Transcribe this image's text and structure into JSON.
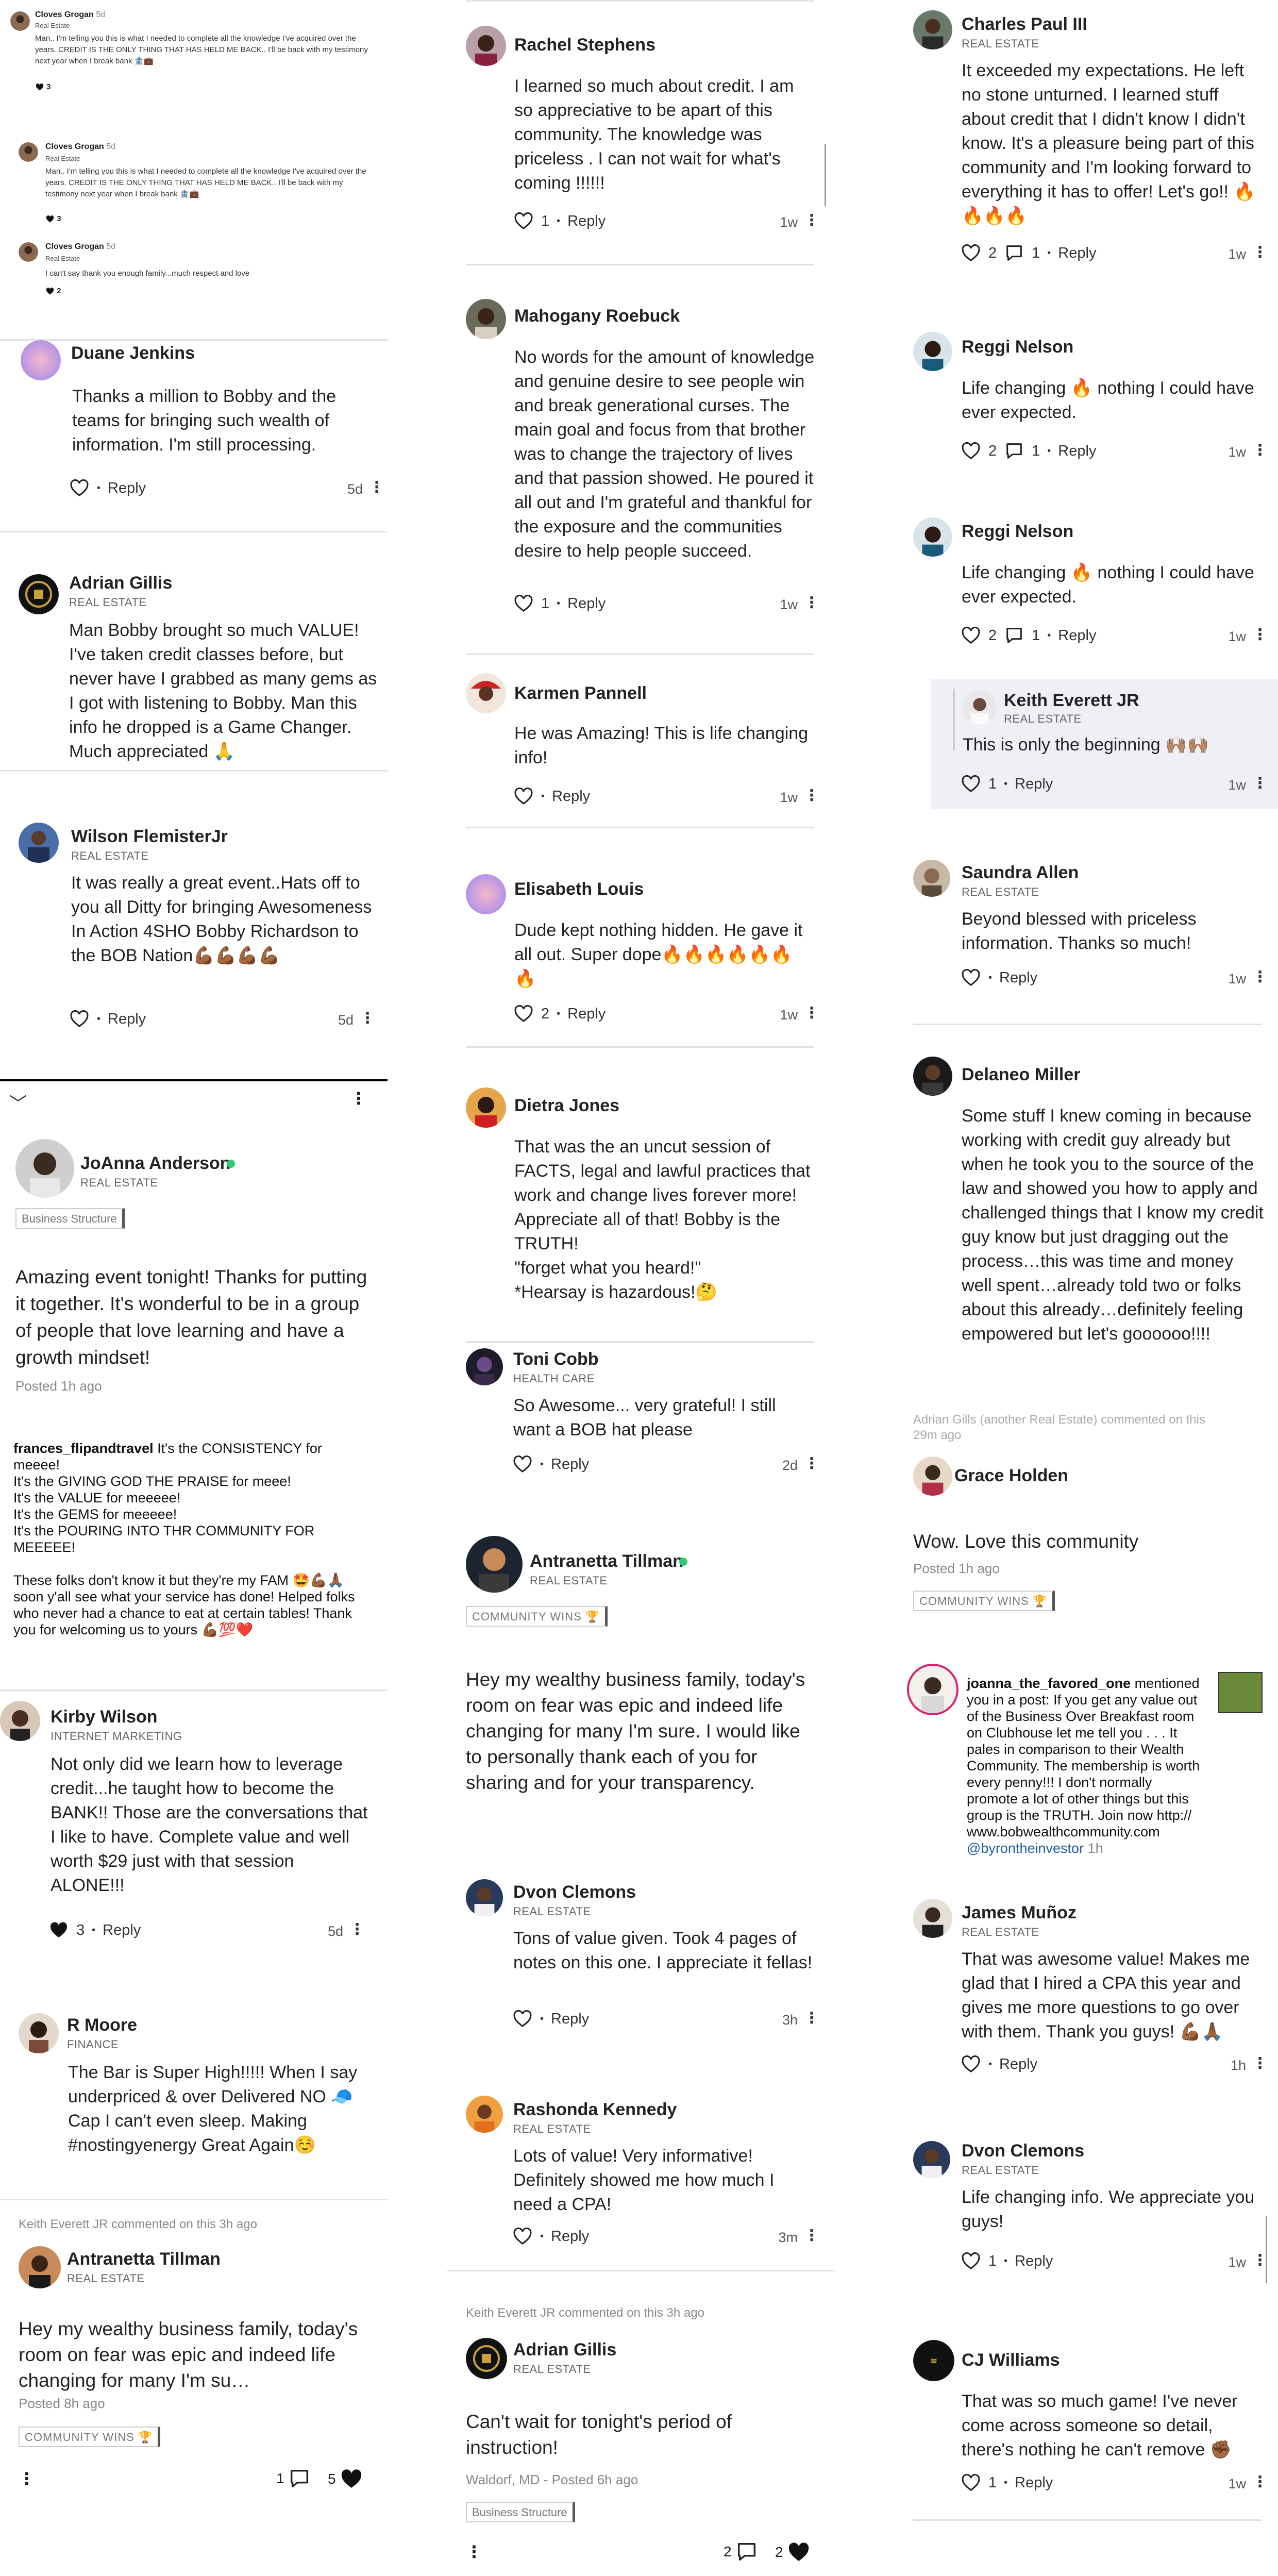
{
  "col1": {
    "top": {
      "c1_name": "Cloves Grogan",
      "c1_time": "5d",
      "c1_role": "Real Estate",
      "c1_text": "Man.. I'm telling you this is what I needed to complete all the knowledge I've acquired over the years. CREDIT IS THE ONLY THING THAT HAS HELD ME BACK.. I'll be back with my testimony next year when I break bank 🏦💼",
      "c1_likes": "3",
      "c2_name": "Cloves Grogan",
      "c2_time": "5d",
      "c2_role": "Real Estate",
      "c2_text": "Man.. I'm telling you this is what I needed to complete all the knowledge I've acquired over the years. CREDIT IS THE ONLY THING THAT HAS HELD ME BACK.. I'll be back with my testimony next year when I break bank 🏦💼",
      "c2_likes": "3",
      "c3_name": "Cloves Grogan",
      "c3_time": "5d",
      "c3_role": "Real Estate",
      "c3_text": "I can't say thank you enough family...much respect and love",
      "c3_likes": "2"
    },
    "duane": {
      "name": "Duane Jenkins",
      "text": "Thanks a million to Bobby and the teams for bringing such wealth of information. I'm still processing.",
      "reply": "Reply",
      "time": "5d"
    },
    "adrian": {
      "name": "Adrian Gillis",
      "role": "REAL ESTATE",
      "text": "Man Bobby brought so much VALUE! I've taken credit classes before, but never have I grabbed as many gems as I got with listening to Bobby. Man this info he dropped is a Game Changer. Much appreciated 🙏"
    },
    "wilson": {
      "name": "Wilson FlemisterJr",
      "role": "REAL ESTATE",
      "text": "It was really a great event..Hats off to you all Ditty for bringing Awesomeness In Action 4SHO Bobby Richardson to the BOB Nation💪🏾💪🏾💪🏾💪🏾",
      "reply": "Reply",
      "time": "5d"
    },
    "joanna": {
      "name": "JoAnna Anderson",
      "role": "REAL ESTATE",
      "tag": "Business Structure",
      "text": "Amazing event tonight! Thanks for putting it together. It's wonderful to be in a group of people that love learning and have a growth mindset!",
      "posted": "Posted 1h ago"
    },
    "frances": {
      "user": "frances_flipandtravel",
      "lines": [
        "It's the CONSISTENCY for",
        "meeee!",
        "It's the GIVING GOD THE PRAISE for meee!",
        "It's the VALUE for meeeee!",
        "It's the GEMS for meeeee!",
        "It's the POURING INTO THR COMMUNITY FOR",
        "MEEEEE!",
        "",
        "These folks don't know it but they're my FAM 🤩💪🏾🙏🏾",
        "soon y'all see what your service has done! Helped folks",
        "who never had a chance to eat at certain tables! Thank",
        "you for welcoming us to yours 💪🏾💯❤️"
      ]
    },
    "kirby": {
      "name": "Kirby Wilson",
      "role": "INTERNET MARKETING",
      "text": "Not only did we learn how to leverage credit...he taught how to become the BANK!! Those are the conversations that I like to have. Complete value and well worth $29 just with that session ALONE!!!",
      "likes": "3",
      "reply": "Reply",
      "time": "5d"
    },
    "rmoore": {
      "name": "R Moore",
      "role": "FINANCE",
      "text": "The Bar is Super High!!!!! When I say underpriced & over Delivered NO 🧢 Cap I can't even sleep. Making #nostingyenergy Great Again☺️"
    },
    "antra": {
      "commented": "Keith Everett JR commented on this 3h ago",
      "name": "Antranetta Tillman",
      "role": "REAL ESTATE",
      "text": "Hey my wealthy business family, today's room on fear was epic and indeed life changing for many I'm su…",
      "posted": "Posted 8h ago",
      "tag": "COMMUNITY WINS 🏆",
      "comments": "1",
      "likes": "5"
    }
  },
  "col2": {
    "rachel": {
      "name": "Rachel Stephens",
      "text": "I learned so much about credit. I am so appreciative to be apart of this community. The knowledge was priceless . I can not wait for what's coming !!!!!!",
      "likes": "1",
      "reply": "Reply",
      "time": "1w"
    },
    "mahogany": {
      "name": "Mahogany Roebuck",
      "text": "No words for the amount of knowledge and genuine desire to see people win and  break generational curses. The main goal and focus from that brother was to change the trajectory of lives and that passion showed. He poured it all out and I'm grateful and thankful for the exposure and the communities desire to help people succeed.",
      "likes": "1",
      "reply": "Reply",
      "time": "1w"
    },
    "karmen": {
      "name": "Karmen Pannell",
      "text": "He was Amazing! This is life changing info!",
      "reply": "Reply",
      "time": "1w"
    },
    "elisabeth": {
      "name": "Elisabeth Louis",
      "text": "Dude kept nothing hidden. He gave it all out. Super dope🔥🔥🔥🔥🔥🔥🔥",
      "likes": "2",
      "reply": "Reply",
      "time": "1w"
    },
    "dietra": {
      "name": "Dietra Jones",
      "text1": "That was the an uncut session of FACTS, legal and lawful practices that work and change lives forever more! Appreciate all of that! Bobby is the TRUTH!",
      "text2": "\"forget what you heard!\"",
      "text3": "*Hearsay is hazardous!🤔"
    },
    "toni": {
      "name": "Toni Cobb",
      "role": "HEALTH CARE",
      "text": "So Awesome... very grateful! I still want a BOB hat please",
      "reply": "Reply",
      "time": "2d"
    },
    "antra": {
      "name": "Antranetta Tillman",
      "role": "REAL ESTATE",
      "tag": "COMMUNITY WINS 🏆",
      "text": "Hey my wealthy business family, today's room on fear was epic and indeed life changing for many I'm sure. I would like to personally thank each of you for sharing and for your transparency."
    },
    "dvon": {
      "name": "Dvon Clemons",
      "role": "REAL ESTATE",
      "text": "Tons of value given. Took 4 pages of notes on this one. I appreciate it fellas!",
      "reply": "Reply",
      "time": "3h"
    },
    "rashonda": {
      "name": "Rashonda Kennedy",
      "role": "REAL ESTATE",
      "text": "Lots of value! Very informative! Definitely showed me how much I need a CPA!",
      "reply": "Reply",
      "time": "3m"
    },
    "adrian2": {
      "commented": "Keith Everett JR commented on this 3h ago",
      "name": "Adrian Gillis",
      "role": "REAL ESTATE",
      "text": "Can't wait for tonight's period of instruction!",
      "posted": "Waldorf, MD - Posted 6h ago",
      "tag": "Business Structure",
      "comments": "2",
      "likes": "2"
    }
  },
  "col3": {
    "charles": {
      "name": "Charles Paul III",
      "role": "REAL ESTATE",
      "text": "It exceeded my expectations. He left no stone unturned. I learned stuff about credit that I didn't know I didn't know. It's a pleasure being part of this community and I'm looking forward to everything it has to offer! Let's go!! 🔥🔥🔥🔥",
      "likes": "2",
      "comments": "1",
      "reply": "Reply",
      "time": "1w"
    },
    "reggi1": {
      "name": "Reggi Nelson",
      "text": "Life changing 🔥 nothing I could have ever expected.",
      "likes": "2",
      "comments": "1",
      "reply": "Reply",
      "time": "1w"
    },
    "reggi2": {
      "name": "Reggi Nelson",
      "text": "Life changing 🔥 nothing I could have ever expected.",
      "likes": "2",
      "comments": "1",
      "reply": "Reply",
      "time": "1w"
    },
    "keith": {
      "name": "Keith Everett JR",
      "role": "REAL ESTATE",
      "text": "This is only the beginning 🙌🏽🙌🏽",
      "likes": "1",
      "reply": "Reply",
      "time": "1w"
    },
    "saundra": {
      "name": "Saundra Allen",
      "role": "REAL ESTATE",
      "text": "Beyond blessed with priceless information. Thanks so much!",
      "reply": "Reply",
      "time": "1w"
    },
    "delaneo": {
      "name": "Delaneo Miller",
      "text": "Some stuff I knew coming in because working with credit guy already but when he took you to the source of the law and showed you how to apply and challenged things that I know my credit guy know but just dragging out the process…this was time and money well spent…already told two or folks about this already…definitely feeling empowered but let's goooooo!!!!"
    },
    "grace": {
      "commented1": "Adrian Gills (another Real Estate) commented on this",
      "commented2": "29m ago",
      "name": "Grace Holden",
      "text": "Wow. Love this community",
      "posted": "Posted 1h ago",
      "tag": "COMMUNITY WINS 🏆"
    },
    "joanna_ig": {
      "user": "joanna_the_favored_one",
      "lines": [
        "mentioned",
        "you in a post: If you get any value out",
        "of the Business Over Breakfast room",
        "on Clubhouse let me tell you . . . It",
        "pales in comparison to their Wealth",
        "Community. The membership is worth",
        "every penny!!! I don't normally",
        "promote a lot of other things but this",
        "group is the TRUTH. Join now http://",
        "www.bobwealthcommunity.com"
      ],
      "mention": "@byrontheinvestor",
      "time": "1h"
    },
    "james": {
      "name": "James Muñoz",
      "role": "REAL ESTATE",
      "text": "That was awesome value! Makes me glad that I hired a CPA this year and gives me more questions to go over with them. Thank you guys! 💪🏾🙏🏾",
      "reply": "Reply",
      "time": "1h"
    },
    "dvon2": {
      "name": "Dvon Clemons",
      "role": "REAL ESTATE",
      "text": "Life changing info. We appreciate you guys!",
      "likes": "1",
      "reply": "Reply",
      "time": "1w"
    },
    "cj": {
      "name": "CJ Williams",
      "text": "That was so much game! I've never come across someone so detail, there's nothing he can't remove ✊🏾",
      "likes": "1",
      "reply": "Reply",
      "time": "1w"
    }
  },
  "common": {
    "reply": "Reply",
    "kebab": "⋮",
    "dot": "•",
    "chevron": "﹀"
  },
  "colors": {
    "separator": "#e0e0e0",
    "online": "#2ecc71",
    "text": "#222222",
    "muted": "#777777",
    "reply_bg": "#eef0f6"
  },
  "icons": [
    "heart-outline-icon",
    "heart-filled-icon",
    "comment-icon",
    "kebab-icon",
    "chevron-down-icon",
    "online-dot-icon"
  ]
}
